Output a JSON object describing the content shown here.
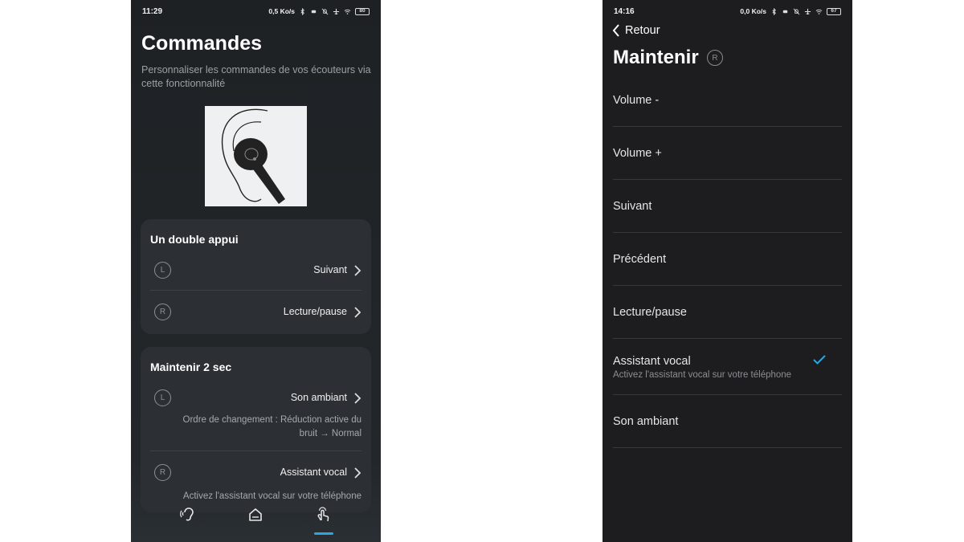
{
  "left_screen": {
    "status_bar": {
      "time": "11:29",
      "speed": "0,5 Ko/s",
      "battery": "80"
    },
    "title": "Commandes",
    "subtitle": "Personnaliser les commandes de vos écouteurs via cette fonctionnalité",
    "double_tap": {
      "title": "Un double appui",
      "rows": [
        {
          "side": "L",
          "value": "Suivant"
        },
        {
          "side": "R",
          "value": "Lecture/pause"
        }
      ]
    },
    "hold": {
      "title": "Maintenir 2 sec",
      "rows": [
        {
          "side": "L",
          "value": "Son ambiant",
          "desc": "Ordre de changement : Réduction active du bruit → Normal"
        },
        {
          "side": "R",
          "value": "Assistant vocal",
          "desc": "Activez l'assistant vocal sur votre téléphone"
        }
      ]
    },
    "nav": {
      "icons": [
        "ear-icon",
        "home-icon",
        "touch-hand-icon"
      ],
      "active": "touch-hand-icon",
      "accent": "#2aa7e0"
    }
  },
  "right_screen": {
    "status_bar": {
      "time": "14:16",
      "speed": "0,0 Ko/s",
      "battery": "67"
    },
    "back_label": "Retour",
    "title": "Maintenir",
    "side_badge": "R",
    "options": [
      {
        "label": "Volume -"
      },
      {
        "label": "Volume +"
      },
      {
        "label": "Suivant"
      },
      {
        "label": "Précédent"
      },
      {
        "label": "Lecture/pause"
      },
      {
        "label": "Assistant vocal",
        "desc": "Activez l'assistant vocal sur votre téléphone",
        "selected": true
      },
      {
        "label": "Son ambiant"
      }
    ],
    "check_color": "#2aa7e0"
  }
}
